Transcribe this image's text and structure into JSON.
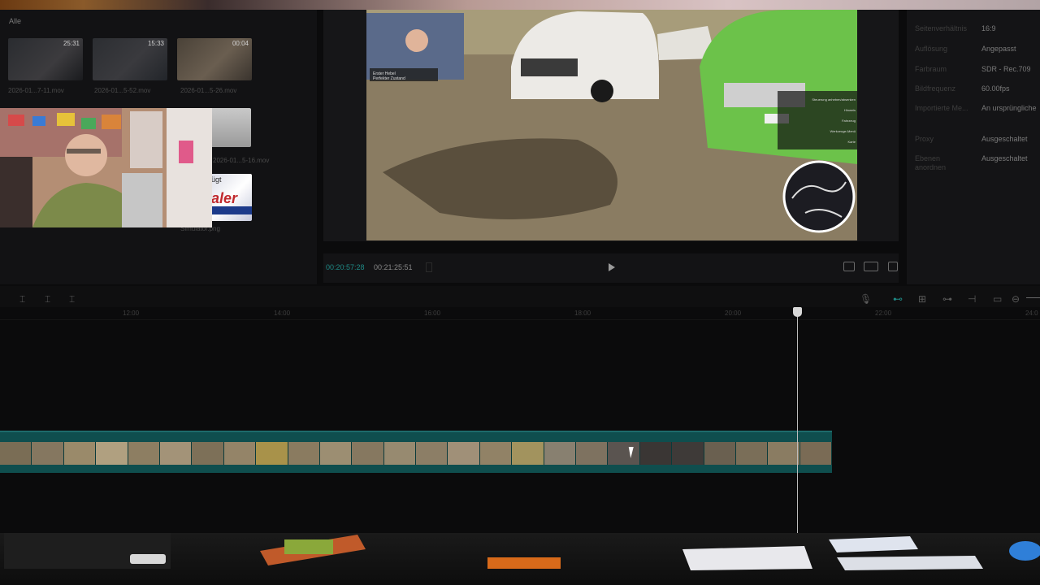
{
  "media_pool": {
    "label": "Alle",
    "thumbnails": [
      {
        "duration": "25:31",
        "caption": "2026-01...7-11.mov"
      },
      {
        "duration": "15:33",
        "caption": "2026-01...5-52.mov"
      },
      {
        "duration": "00:04",
        "caption": "2026-01...5-26.mov"
      },
      {
        "duration": "",
        "caption": "2026-01...5-16.mov"
      },
      {
        "duration": "",
        "caption": "Simulator.png"
      }
    ],
    "overlay_text": "ügt"
  },
  "viewer": {
    "timecode_current": "00:20:57:28",
    "timecode_total": "00:21:25:51",
    "game_caption_1": "Erster Hebel",
    "game_caption_2": "Perfekter Zustand",
    "game_menu": [
      "Steuerung anheben/absenken",
      "Hinweis",
      "Fahrzeug",
      "Werkzeuge-Menü",
      "Karte"
    ]
  },
  "inspector": {
    "rows": [
      {
        "label": "Seitenverhältnis",
        "value": "16:9"
      },
      {
        "label": "Auflösung",
        "value": "Angepasst"
      },
      {
        "label": "Farbraum",
        "value": "SDR - Rec.709"
      },
      {
        "label": "Bildfrequenz",
        "value": "60.00fps"
      },
      {
        "label": "Importierte Me...",
        "value": "An ursprüngliche"
      },
      {
        "label": "Proxy",
        "value": "Ausgeschaltet"
      },
      {
        "label": "Ebenen anordnen",
        "value": "Ausgeschaltet"
      }
    ]
  },
  "timeline": {
    "ruler_labels": [
      "12:00",
      "14:00",
      "16:00",
      "18:00",
      "20:00",
      "22:00",
      "24:0"
    ]
  },
  "colors": {
    "accent": "#1f8a86",
    "clip": "#0f4e4e"
  }
}
